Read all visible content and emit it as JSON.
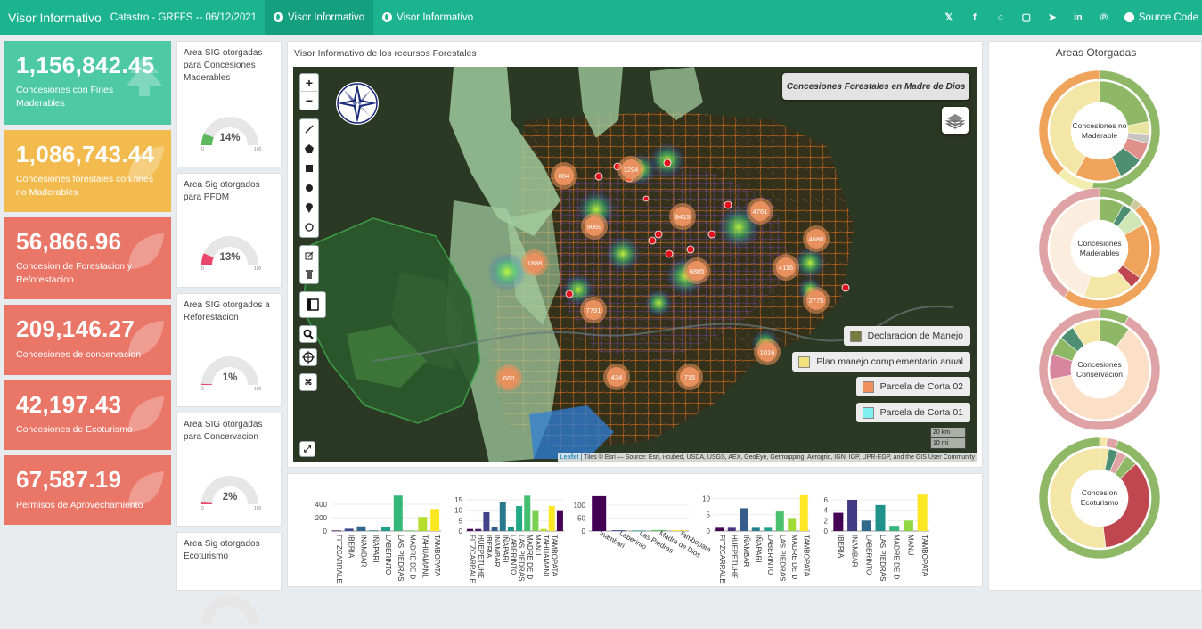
{
  "navbar": {
    "brand": "Visor Informativo",
    "subtitle": "Catastro - GRFFS -- 06/12/2021",
    "tabs": [
      {
        "label": "Visor Informativo",
        "active": true
      },
      {
        "label": "Visor Informativo",
        "active": false
      }
    ],
    "socials": [
      "twitter-icon",
      "facebook-icon",
      "whatsapp-icon",
      "instagram-icon",
      "telegram-icon",
      "linkedin-icon",
      "pinterest-icon"
    ],
    "source_code": "Source Code"
  },
  "kpis": [
    {
      "value": "1,156,842.45",
      "label": "Concesiones con Fines Maderables",
      "color": "#4dc9a3",
      "icon": "tree-icon"
    },
    {
      "value": "1,086,743.44",
      "label": "Concesiones forestales con fines no Maderables",
      "color": "#f3bb4e",
      "icon": "leaf-icon"
    },
    {
      "value": "56,866.96",
      "label": "Concesion de Forestacion y Reforestacion",
      "color": "#ea7668",
      "icon": "leaf-icon"
    },
    {
      "value": "209,146.27",
      "label": "Concesiones de concervacion",
      "color": "#ea7668",
      "icon": "leaf-icon"
    },
    {
      "value": "42,197.43",
      "label": "Concesiones de Ecoturismo",
      "color": "#ea7668",
      "icon": "leaf-icon"
    },
    {
      "value": "67,587.19",
      "label": "Permisos de Aprovechamiento",
      "color": "#ea7668",
      "icon": "leaf-icon"
    }
  ],
  "gauges": [
    {
      "title": "Area SIG otorgadas para Concesiones Maderables",
      "percent": 14,
      "pct_label": "14%",
      "min": "0",
      "max": "100",
      "color": "#5cb85c"
    },
    {
      "title": "Area Sig otorgados para PFDM",
      "percent": 13,
      "pct_label": "13%",
      "min": "0",
      "max": "100",
      "color": "#e8466a"
    },
    {
      "title": "Area SIG otorgados a Reforestacion",
      "percent": 1,
      "pct_label": "1%",
      "min": "0",
      "max": "100",
      "color": "#e8466a"
    },
    {
      "title": "Area SIG otorgadas para Concervacion",
      "percent": 2,
      "pct_label": "2%",
      "min": "0",
      "max": "100",
      "color": "#e8466a"
    },
    {
      "title": "Area Sig otorgados Ecoturismo",
      "percent": null,
      "pct_label": "",
      "min": "",
      "max": "",
      "color": "#e8466a"
    }
  ],
  "map": {
    "panel_title": "Visor Informativo de los recursos Forestales",
    "map_title": "Concesiones Forestales en Madre de Dios",
    "zoom_in": "+",
    "zoom_out": "−",
    "clusters": [
      "884",
      "1294",
      "9069",
      "9415",
      "4761",
      "4680",
      "1888",
      "6885",
      "4116",
      "2775",
      "7791",
      "1016",
      "660",
      "434",
      "715"
    ],
    "legend": [
      {
        "label": "Declaracion de Manejo",
        "color": "#7a7a45"
      },
      {
        "label": "Plan manejo complementario anual",
        "color": "#f2e17c"
      },
      {
        "label": "Parcela de Corta 02",
        "color": "#f0905f"
      },
      {
        "label": "Parcela de Corta 01",
        "color": "#7ef0f0"
      }
    ],
    "scale": [
      "20 km",
      "10 mi"
    ],
    "attribution_link": "Leaflet",
    "attribution": "| Tiles © Esri — Source: Esri, i-cubed, USDA, USGS, AEX, GeoEye, Getmapping, Aerogrid, IGN, IGP, UPR-EGP, and the GIS User Community"
  },
  "chart_data": [
    {
      "type": "bar",
      "categories": [
        "FITZCARRALD",
        "IBERIA",
        "INAMBARI",
        "IÑAPARI",
        "LABERINTO",
        "LAS PIEDRAS",
        "MADRE DE DIOS",
        "TAHUAMANU",
        "TAMBOPATA"
      ],
      "tick_labels": [
        "FITZCARRALE",
        "IBERIA",
        "INAMBARI",
        "IÑAPARI",
        "LABERINTO",
        "LAS PIEDRAS",
        "MADRE DE D",
        "TAHUAMANL",
        "TAMBOPATA"
      ],
      "values": [
        8,
        35,
        70,
        10,
        55,
        530,
        10,
        210,
        330
      ],
      "colors": [
        "#440154",
        "#3e4a89",
        "#31688e",
        "#26828e",
        "#1f9e89",
        "#35b779",
        "#6ece58",
        "#b5de2b",
        "#fde725"
      ],
      "yticks": [
        "400",
        "200",
        "0"
      ],
      "ylim": [
        0,
        560
      ]
    },
    {
      "type": "bar",
      "categories": [
        "FITZCARRALD",
        "HUEPETUHE",
        "IBERIA",
        "INAMBARI",
        "IÑAPARI",
        "LABERINTO",
        "LAS PIEDRAS",
        "MADRE DE DIOS",
        "MANU",
        "TAHUAMANU",
        "TAMBOPATA"
      ],
      "tick_labels": [
        "FITZCARRALE",
        "HUEPETUHE",
        "IBERIA",
        "INAMBARI",
        "IÑAPARI",
        "LABERINTO",
        "LAS PIEDRAS",
        "MADRE DE D",
        "MANU",
        "TAHUAMANL",
        "TAMBOPATA"
      ],
      "values": [
        1,
        1,
        9,
        2,
        14,
        2,
        12,
        17,
        10,
        1,
        12,
        10
      ],
      "colors": [
        "#440154",
        "#482475",
        "#414487",
        "#355f8d",
        "#2a788e",
        "#21918c",
        "#22a884",
        "#44bf70",
        "#7ad151",
        "#bddf26",
        "#fde725"
      ],
      "yticks": [
        "15",
        "10",
        "5",
        "0"
      ],
      "ylim": [
        0,
        18
      ]
    },
    {
      "type": "bar",
      "categories": [
        "Inambari",
        "Laberinto",
        "Las Piedras",
        "Madre de Dios",
        "Tambopata"
      ],
      "tick_labels": [
        "Inambari",
        "Laberinto",
        "Las Piedras",
        "Madre de Dios",
        "Tambopata"
      ],
      "values": [
        135,
        3,
        2,
        4,
        3
      ],
      "colors": [
        "#440154",
        "#3b528b",
        "#21918c",
        "#5ec962",
        "#fde725"
      ],
      "yticks": [
        "100",
        "50",
        "0"
      ],
      "ylim": [
        0,
        145
      ]
    },
    {
      "type": "bar",
      "categories": [
        "FITZCARRALD",
        "HUEPETUHE",
        "IBERIA",
        "INAMBARI",
        "IÑAPARI",
        "LABERINTO",
        "LAS PIEDRAS",
        "MADRE DE DIOS",
        "TAMBOPATA"
      ],
      "tick_labels": [
        "FITZCARRALE",
        "HUEPETUHE",
        "IÑAMBARI",
        "IÑAPARI",
        "LABERINTO",
        "LAS PIEDRAS",
        "MADRE DE D",
        "TAMBOPATA"
      ],
      "values": [
        1,
        1,
        7,
        1,
        1,
        6,
        4,
        11
      ],
      "colors": [
        "#440154",
        "#46327e",
        "#365c8d",
        "#277f8e",
        "#1fa187",
        "#4ac16d",
        "#a0da39",
        "#fde725"
      ],
      "yticks": [
        "10",
        "5",
        "0"
      ],
      "ylim": [
        0,
        11.5
      ]
    },
    {
      "type": "bar",
      "categories": [
        "IBERIA",
        "INAMBARI",
        "LABERINTO",
        "LAS PIEDRAS",
        "MADRE DE DIOS",
        "MANU",
        "TAMBOPATA"
      ],
      "tick_labels": [
        "IBERIA",
        "INAMBARI",
        "LABERINTO",
        "LAS PIEDRAS",
        "MADRE DE D",
        "MANU",
        "TAMBOPATA"
      ],
      "values": [
        3.5,
        6,
        2,
        5,
        1,
        2,
        7
      ],
      "colors": [
        "#440154",
        "#443983",
        "#31688e",
        "#21918c",
        "#35b779",
        "#90d743",
        "#fde725"
      ],
      "yticks": [
        "6",
        "4",
        "2",
        "0"
      ],
      "ylim": [
        0,
        7.2
      ]
    }
  ],
  "donuts": {
    "title": "Areas Otorgadas",
    "items": [
      {
        "label": "Concesiones no Maderable",
        "outer": [
          {
            "v": 52,
            "c": "#8fb866"
          },
          {
            "v": 10,
            "c": "#f3eeb0"
          },
          {
            "v": 38,
            "c": "#f0a35a"
          }
        ],
        "inner": [
          {
            "v": 22,
            "c": "#8fb866"
          },
          {
            "v": 4,
            "c": "#e9e4a0"
          },
          {
            "v": 3,
            "c": "#c9c4c0"
          },
          {
            "v": 6,
            "c": "#e0908a"
          },
          {
            "v": 8,
            "c": "#4e8f74"
          },
          {
            "v": 15,
            "c": "#f0a35a"
          },
          {
            "v": 42,
            "c": "#f3e6a6"
          }
        ]
      },
      {
        "label": "Concesiones Maderables",
        "outer": [
          {
            "v": 10,
            "c": "#8fb866"
          },
          {
            "v": 2,
            "c": "#cfc9a0"
          },
          {
            "v": 48,
            "c": "#f0a35a"
          },
          {
            "v": 40,
            "c": "#dfa3a6"
          }
        ],
        "inner": [
          {
            "v": 8,
            "c": "#8fb866"
          },
          {
            "v": 3,
            "c": "#4e8f74"
          },
          {
            "v": 6,
            "c": "#cfe7b5"
          },
          {
            "v": 18,
            "c": "#f0a35a"
          },
          {
            "v": 4,
            "c": "#c0464f"
          },
          {
            "v": 16,
            "c": "#f3e6a6"
          },
          {
            "v": 45,
            "c": "#fbeede"
          }
        ]
      },
      {
        "label": "Concesiones Conservacion",
        "outer": [
          {
            "v": 8,
            "c": "#8fb866"
          },
          {
            "v": 92,
            "c": "#dfa3a6"
          }
        ],
        "inner": [
          {
            "v": 10,
            "c": "#8fb866"
          },
          {
            "v": 62,
            "c": "#fbdfc6"
          },
          {
            "v": 8,
            "c": "#d8869f"
          },
          {
            "v": 6,
            "c": "#8fb866"
          },
          {
            "v": 5,
            "c": "#4e8f74"
          },
          {
            "v": 9,
            "c": "#f3e6a6"
          }
        ]
      },
      {
        "label": "Concesion Ecoturismo",
        "outer": [
          {
            "v": 2,
            "c": "#f3e6a6"
          },
          {
            "v": 3,
            "c": "#dfa3a6"
          },
          {
            "v": 95,
            "c": "#8fb866"
          }
        ],
        "inner": [
          {
            "v": 3,
            "c": "#f3e6a6"
          },
          {
            "v": 3,
            "c": "#4e8f74"
          },
          {
            "v": 3,
            "c": "#dfa3a6"
          },
          {
            "v": 4,
            "c": "#8fb866"
          },
          {
            "v": 35,
            "c": "#c0464f"
          },
          {
            "v": 52,
            "c": "#f3e6a6"
          }
        ]
      }
    ]
  }
}
